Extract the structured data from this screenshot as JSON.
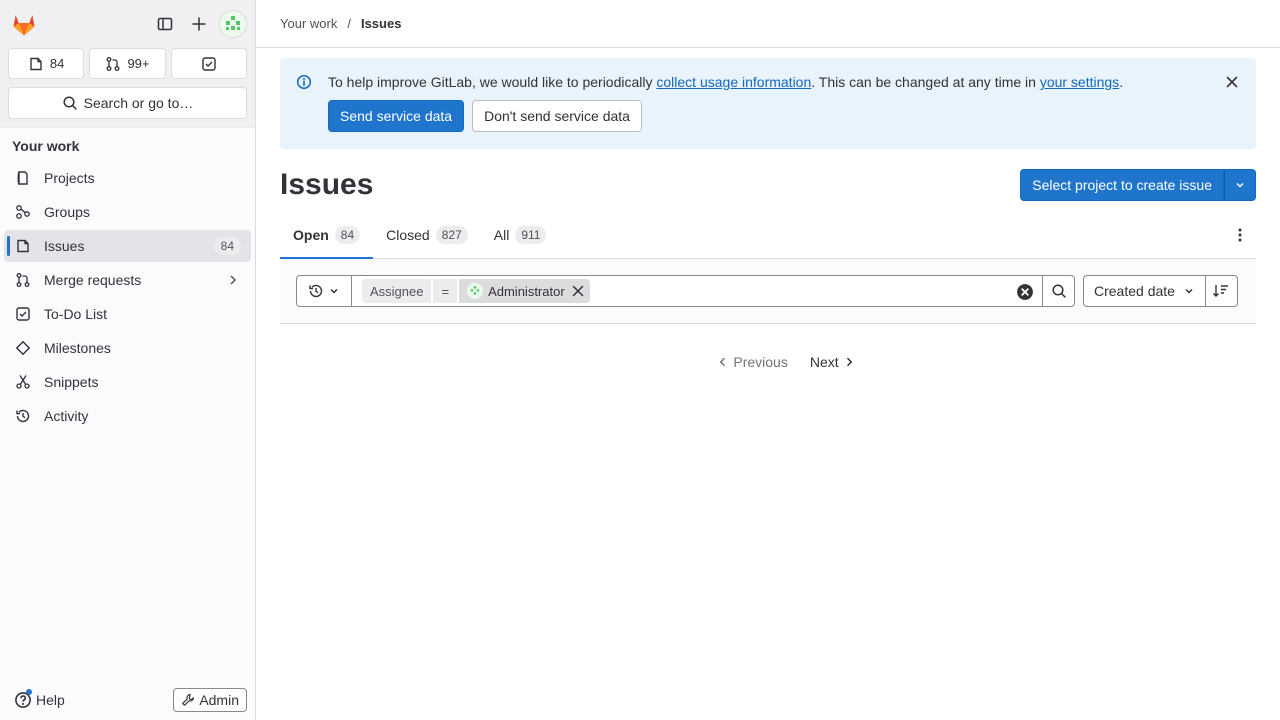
{
  "sidebar": {
    "counts": {
      "issues": "84",
      "merge_requests": "99+"
    },
    "search_label": "Search or go to…",
    "section_title": "Your work",
    "items": [
      {
        "label": "Projects",
        "icon": "project-icon"
      },
      {
        "label": "Groups",
        "icon": "group-icon"
      },
      {
        "label": "Issues",
        "icon": "issues-icon",
        "badge": "84",
        "active": true
      },
      {
        "label": "Merge requests",
        "icon": "merge-request-icon"
      },
      {
        "label": "To-Do List",
        "icon": "todo-icon"
      },
      {
        "label": "Milestones",
        "icon": "milestone-icon"
      },
      {
        "label": "Snippets",
        "icon": "snippet-icon"
      },
      {
        "label": "Activity",
        "icon": "history-icon"
      }
    ],
    "help_label": "Help",
    "admin_label": "Admin"
  },
  "breadcrumb": {
    "parent": "Your work",
    "separator": "/",
    "current": "Issues"
  },
  "alert": {
    "text_before": "To help improve GitLab, we would like to periodically ",
    "link1": "collect usage information",
    "text_middle": ". This can be changed at any time in ",
    "link2": "your settings",
    "text_after": ".",
    "primary_label": "Send service data",
    "secondary_label": "Don't send service data"
  },
  "page": {
    "title": "Issues",
    "create_button": "Select project to create issue"
  },
  "tabs": [
    {
      "label": "Open",
      "count": "84",
      "active": true
    },
    {
      "label": "Closed",
      "count": "827"
    },
    {
      "label": "All",
      "count": "911"
    }
  ],
  "filter": {
    "token_field": "Assignee",
    "token_operator": "=",
    "token_value": "Administrator",
    "sort_label": "Created date"
  },
  "pagination": {
    "prev": "Previous",
    "next": "Next"
  },
  "colors": {
    "accent": "#1f75cb",
    "alert_bg": "#e9f3fc",
    "logo_orange": "#e24329"
  }
}
